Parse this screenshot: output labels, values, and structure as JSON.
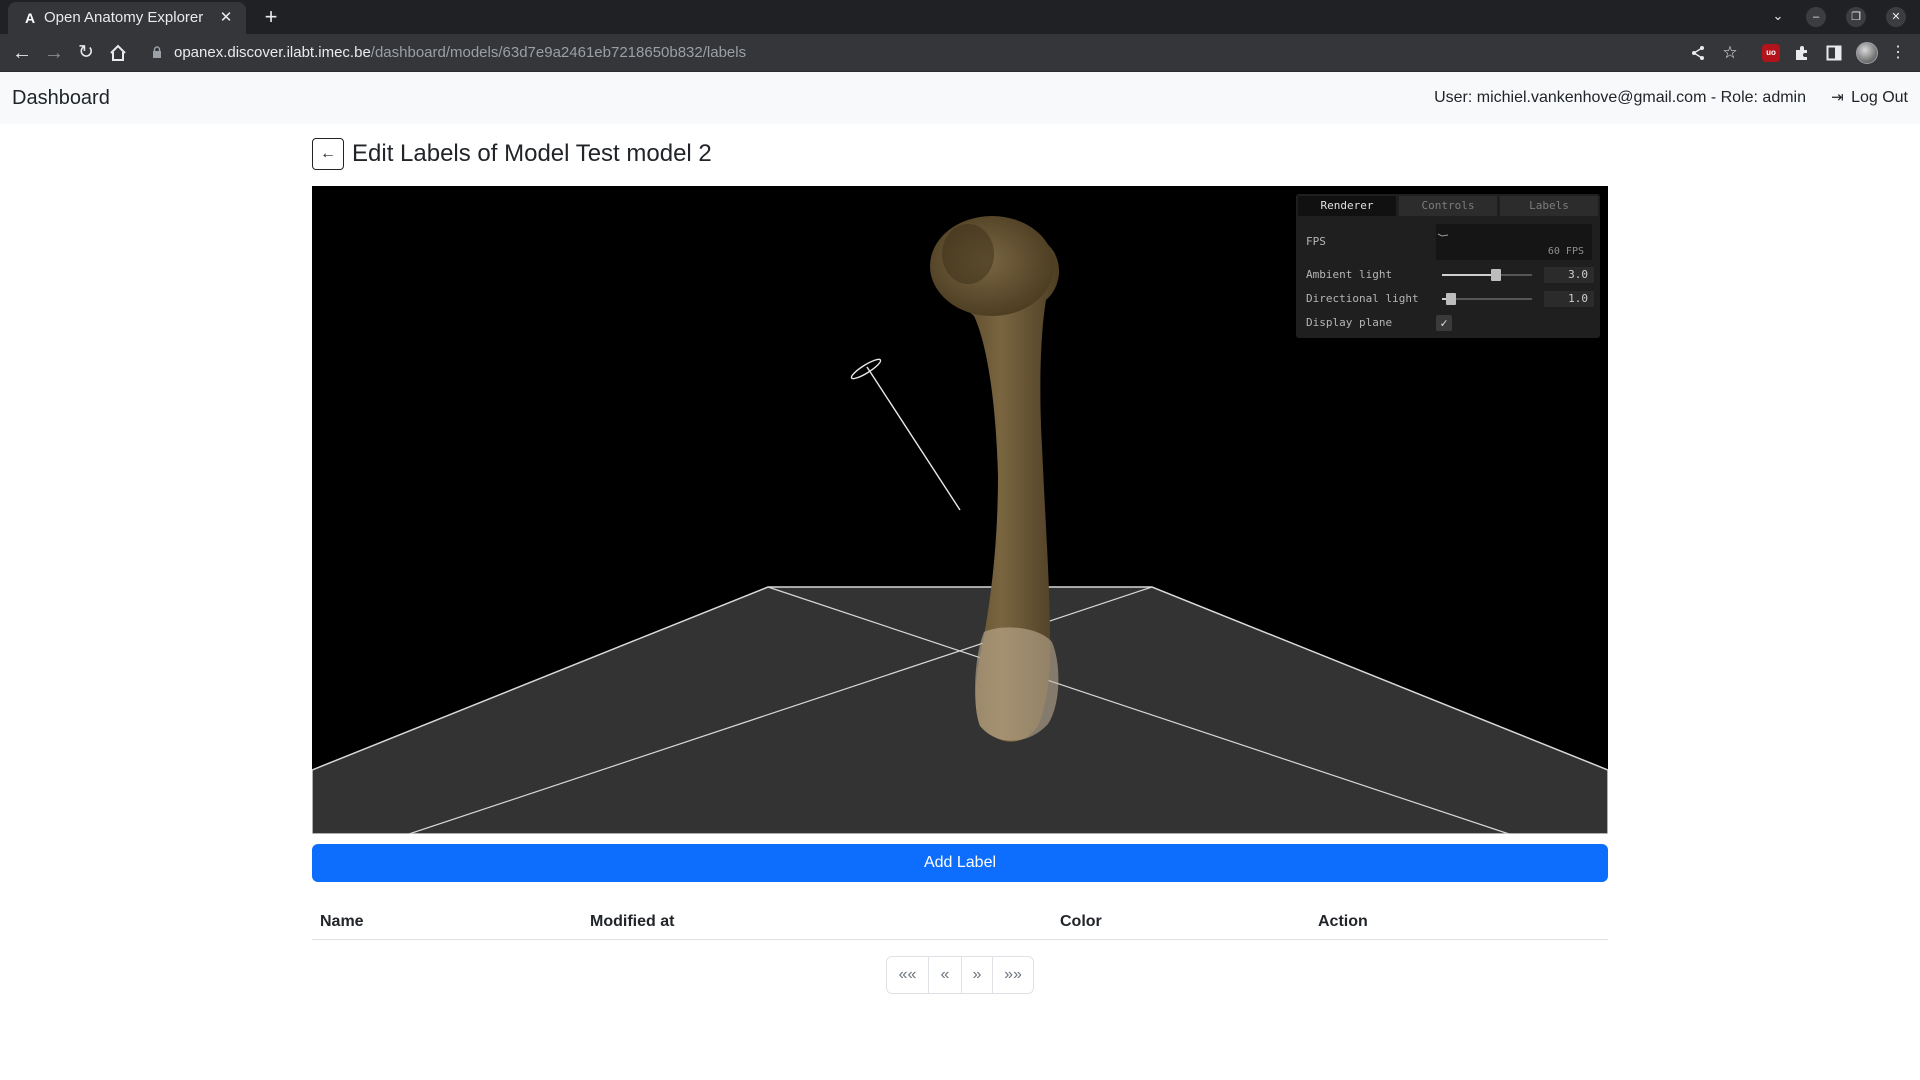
{
  "browser": {
    "tab_title": "Open Anatomy Explorer",
    "tab_favicon": "A",
    "url_host": "opanex.discover.ilabt.imec.be",
    "url_path": "/dashboard/models/63d7e9a2461eb7218650b832/labels"
  },
  "navbar": {
    "brand": "Dashboard",
    "user_info": "User: michiel.vankenhove@gmail.com - Role: admin",
    "logout_label": "Log Out"
  },
  "page": {
    "back_icon": "←",
    "title": "Edit Labels of Model Test model 2"
  },
  "gui": {
    "tabs": [
      "Renderer",
      "Controls",
      "Labels"
    ],
    "active_tab": "Renderer",
    "fps_label": "FPS",
    "fps_value": "60 FPS",
    "ambient_label": "Ambient light",
    "ambient_value": "3.0",
    "ambient_fraction": 0.6,
    "directional_label": "Directional light",
    "directional_value": "1.0",
    "directional_fraction": 0.1,
    "display_plane_label": "Display plane",
    "display_plane_checked": true
  },
  "actions": {
    "add_label": "Add Label"
  },
  "table": {
    "columns": [
      "Name",
      "Modified at",
      "Color",
      "Action"
    ]
  },
  "pagination": {
    "first": "««",
    "prev": "«",
    "next": "»",
    "last": "»»"
  },
  "colors": {
    "primary": "#0d6efd",
    "viewer_background": "#000000",
    "plane": "#333333",
    "bone": "#6b5735"
  }
}
